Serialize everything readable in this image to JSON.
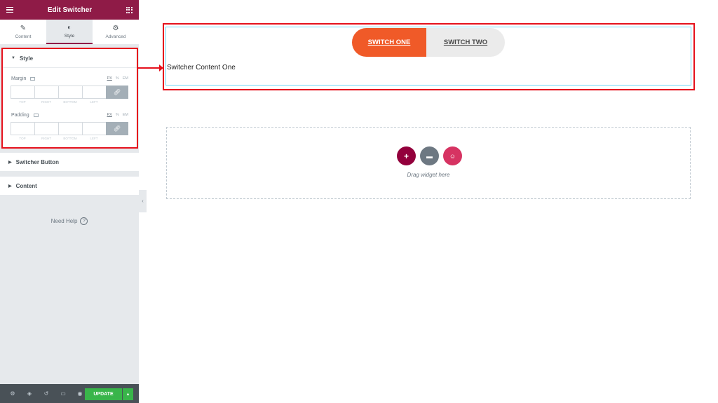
{
  "panel": {
    "title": "Edit Switcher",
    "tabs": [
      {
        "label": "Content",
        "icon": "pencil-icon"
      },
      {
        "label": "Style",
        "icon": "contrast-icon"
      },
      {
        "label": "Advanced",
        "icon": "gear-icon"
      }
    ],
    "style_section": {
      "title": "Style",
      "margin_label": "Margin",
      "padding_label": "Padding",
      "units": [
        "PX",
        "%",
        "EM"
      ],
      "dim_labels": [
        "TOP",
        "RIGHT",
        "BOTTOM",
        "LEFT"
      ]
    },
    "sections": [
      "Switcher Button",
      "Content"
    ],
    "help": "Need Help",
    "update_label": "UPDATE"
  },
  "canvas": {
    "switch_one": "SWITCH ONE",
    "switch_two": "SWITCH TWO",
    "content": "Switcher Content One",
    "drag_text": "Drag widget here"
  },
  "colors": {
    "brand": "#8f1b47",
    "active_switch": "#f05a28",
    "highlight": "#e5111c",
    "update": "#39b54a"
  }
}
